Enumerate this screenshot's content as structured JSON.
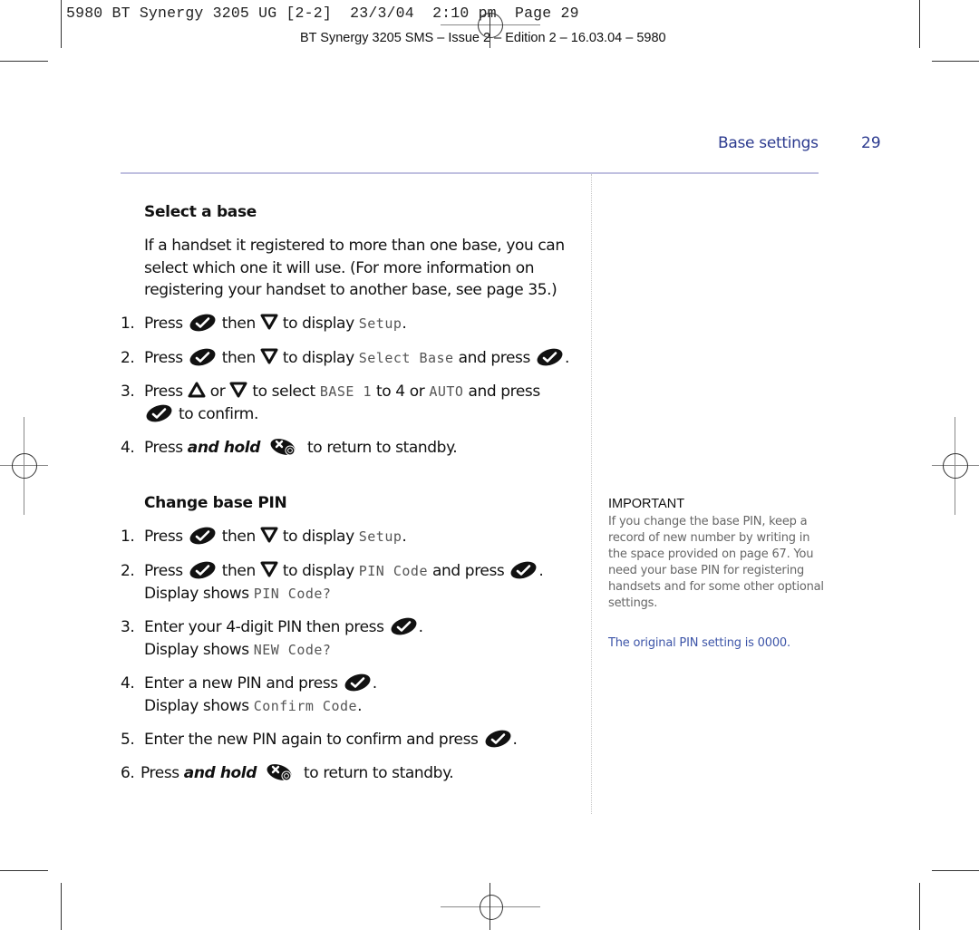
{
  "slug": {
    "text": "5980 BT Synergy 3205 UG [2-2]  23/3/04  2:10 pm  Page 29",
    "edition": "BT Synergy 3205 SMS – Issue 2 – Edition 2 – 16.03.04 – 5980"
  },
  "header": {
    "section": "Base settings",
    "page_number": "29",
    "accent_color": "#2b3a8f"
  },
  "icons": {
    "ok_key": "ok-check-key-icon",
    "down_key": "down-arrow-key-icon",
    "up_key": "up-arrow-key-icon",
    "end_key": "end-call-power-key-icon"
  },
  "select_base": {
    "heading": "Select a base",
    "intro": [
      "If a handset it registered to more than one base, you can",
      "select which one it will use. (For more information on",
      "registering your handset to another base, see page 35.)"
    ],
    "steps": [
      {
        "num": "1.",
        "t1": "Press",
        "t2": "then",
        "t3": "to display",
        "lcd": "Setup",
        "t4": "."
      },
      {
        "num": "2.",
        "t1": "Press",
        "t2": "then",
        "t3": "to display",
        "lcd": "Select Base",
        "t4": "and press",
        "t5": "."
      },
      {
        "num": "3.",
        "t1": "Press",
        "t2": "or",
        "t3": "to select",
        "lcd": "BASE 1",
        "t4": "to 4 or",
        "lcd2": "AUTO",
        "t5": "and press",
        "t6": "to confirm."
      },
      {
        "num": "4.",
        "t1": "Press",
        "emph": "and hold",
        "t2": "to return to standby."
      }
    ]
  },
  "change_pin": {
    "heading": "Change base PIN",
    "steps": [
      {
        "num": "1.",
        "t1": "Press",
        "t2": "then",
        "t3": "to display",
        "lcd": "Setup",
        "t4": "."
      },
      {
        "num": "2.",
        "t1": "Press",
        "t2": "then",
        "t3": "to display",
        "lcd": "PIN Code",
        "t4": "and press",
        "t5": ".",
        "l2": "Display shows",
        "lcd2": "PIN Code?"
      },
      {
        "num": "3.",
        "t1": "Enter your 4-digit PIN then press",
        "t2": ".",
        "l2": "Display shows",
        "lcd2": "NEW Code?"
      },
      {
        "num": "4.",
        "t1": "Enter a new PIN and press",
        "t2": ".",
        "l2": "Display shows",
        "lcd2": "Confirm Code",
        "t3": "."
      },
      {
        "num": "5.",
        "t1": "Enter the new PIN again to confirm and press",
        "t2": "."
      },
      {
        "num": "6.",
        "t1": "Press",
        "emph": "and hold",
        "t2": "to return to standby."
      }
    ]
  },
  "sidebar_note": {
    "title": "IMPORTANT",
    "body": "If you change the base PIN, keep a record of new number by writing in the space provided on page 67. You need your base PIN for registering handsets and for some other optional settings.",
    "pin_note": "The original PIN setting is 0000."
  }
}
